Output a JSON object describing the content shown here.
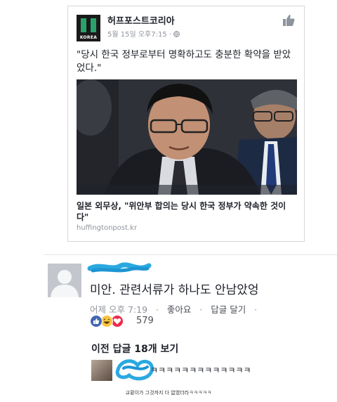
{
  "post": {
    "page_name": "허프포스트코리아",
    "logo_text": "KOREA",
    "meta": "5월 15일 오후7:15 · ",
    "quote": "\"당시 한국 정부로부터 명확하고도 충분한 확약을 받았었다.\"",
    "link_title": "일본 외무상, \"위안부 합의는 당시 한국 정부가 약속한 것이다\"",
    "link_domain": "huffingtonpost.kr"
  },
  "comment": {
    "text": "미안. 관련서류가 하나도 안남았엉",
    "time": "어제 오후 7:19",
    "like_label": "좋아요",
    "reply_label": "답글 달기",
    "reaction_count": "579",
    "reactions": [
      "like",
      "haha",
      "love"
    ]
  },
  "replies": {
    "previous_label": "이전 답글 18개 보기",
    "reply_text": "ㅋㅋㅋㅋㅋㅋㅋㅋㅋㅋㅋㅋㅋ"
  },
  "footer_caption": "교황이가 그것까지 다 없앴더라ㅋㅋㅋㅋㅋ",
  "colors": {
    "fb_blue": "#4267b2",
    "scribble": "#2aa9e0",
    "logo_green": "#2aa26b",
    "gray_text": "#90949c"
  }
}
